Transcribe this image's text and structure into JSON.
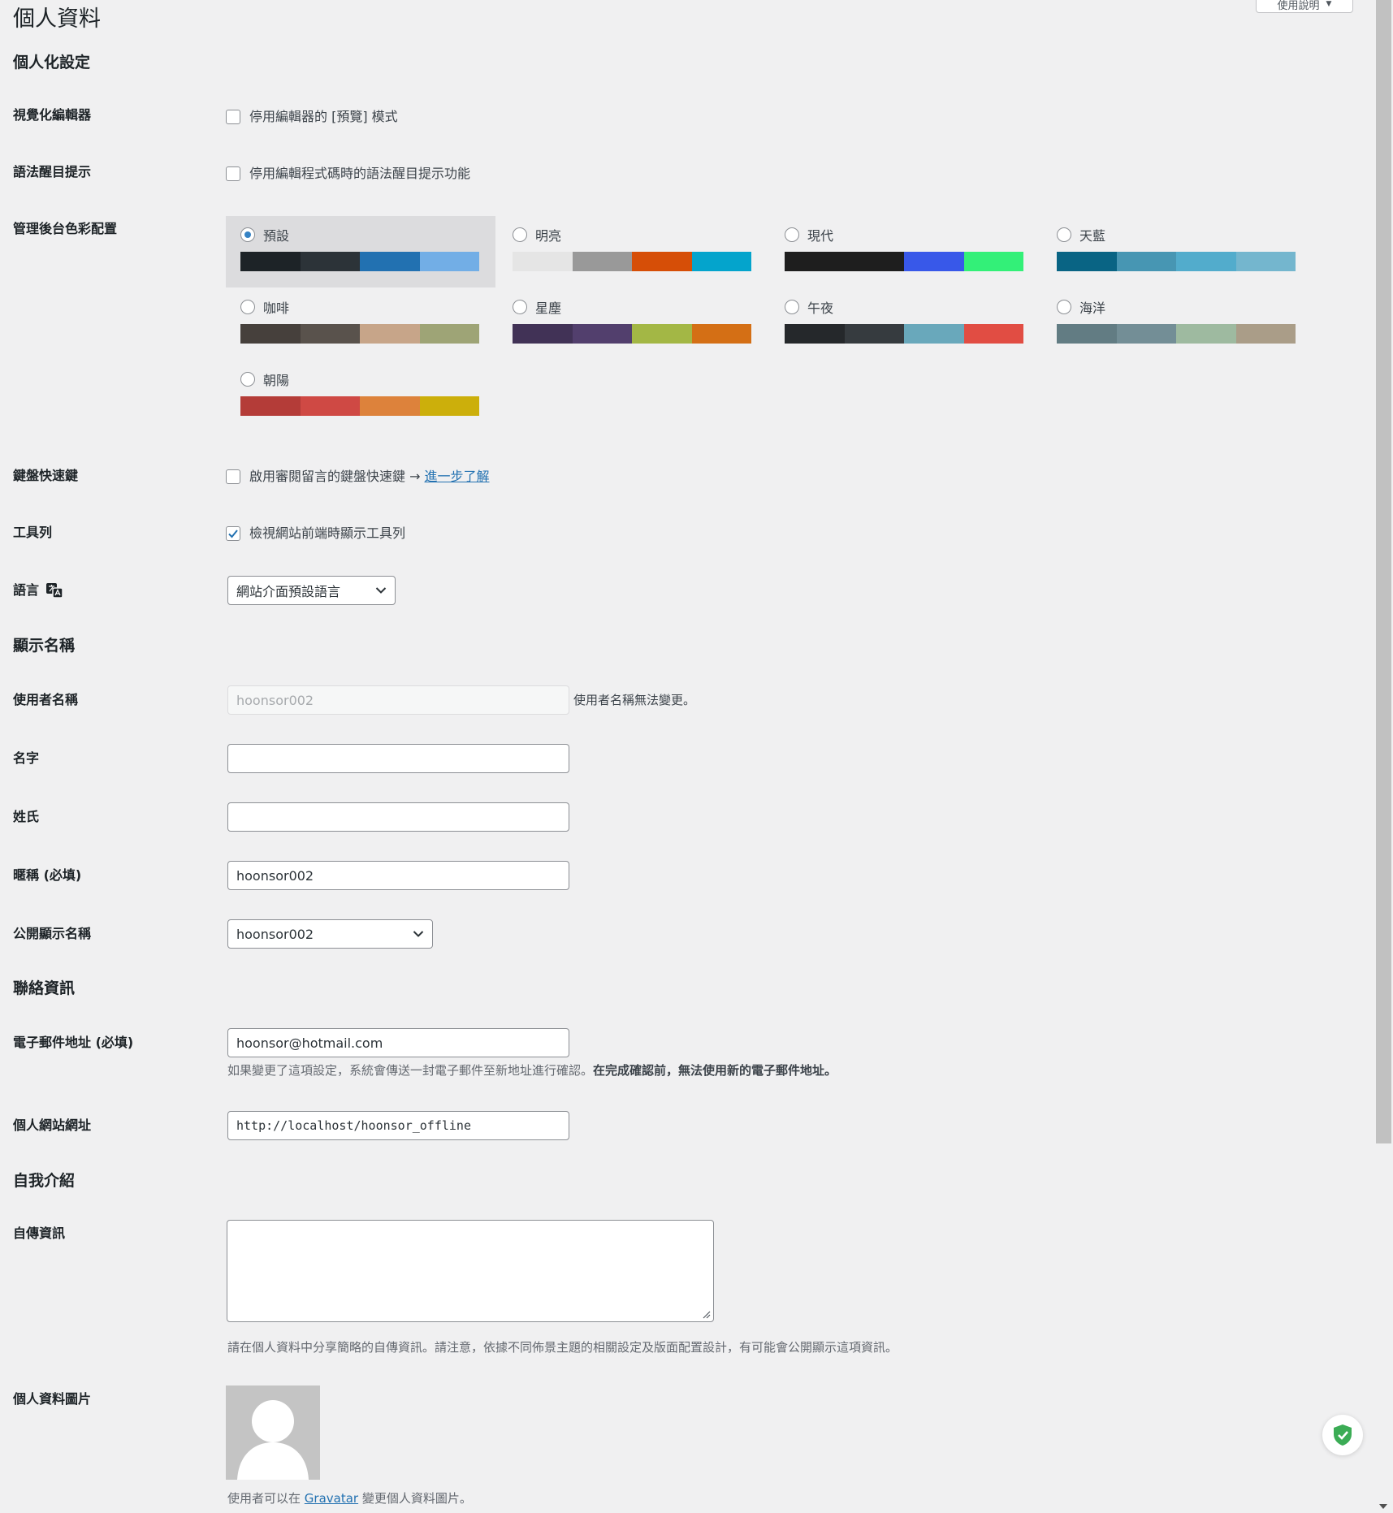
{
  "page": {
    "title": "個人資料",
    "help_label": "使用說明"
  },
  "sections": {
    "personal": "個人化設定",
    "name": "顯示名稱",
    "contact": "聯絡資訊",
    "about": "自我介紹"
  },
  "fields": {
    "visual_editor": {
      "label": "視覺化編輯器",
      "option": "停用編輯器的 [預覽] 模式",
      "checked": false
    },
    "syntax": {
      "label": "語法醒目提示",
      "option": "停用編輯程式碼時的語法醒目提示功能",
      "checked": false
    },
    "color_scheme": {
      "label": "管理後台色彩配置",
      "schemes": [
        {
          "name": "預設",
          "selected": true,
          "colors": [
            "#1d2327",
            "#2c3338",
            "#2271b1",
            "#72aee6"
          ]
        },
        {
          "name": "明亮",
          "selected": false,
          "colors": [
            "#e5e5e5",
            "#999999",
            "#d64e07",
            "#04a4cc"
          ]
        },
        {
          "name": "現代",
          "selected": false,
          "colors": [
            "#1e1e1e",
            "#1e1e1e",
            "#3858e9",
            "#33f078"
          ]
        },
        {
          "name": "天藍",
          "selected": false,
          "colors": [
            "#096484",
            "#4796b3",
            "#52accc",
            "#74b6ce"
          ]
        },
        {
          "name": "咖啡",
          "selected": false,
          "colors": [
            "#46403c",
            "#59524c",
            "#c7a589",
            "#9ea476"
          ]
        },
        {
          "name": "星塵",
          "selected": false,
          "colors": [
            "#413256",
            "#523f6d",
            "#a3b745",
            "#d46f15"
          ]
        },
        {
          "name": "午夜",
          "selected": false,
          "colors": [
            "#25282b",
            "#363b3f",
            "#69a8bb",
            "#e14d43"
          ]
        },
        {
          "name": "海洋",
          "selected": false,
          "colors": [
            "#627c83",
            "#738e96",
            "#9ebaa0",
            "#aa9d88"
          ]
        },
        {
          "name": "朝陽",
          "selected": false,
          "colors": [
            "#b43c38",
            "#cf4944",
            "#dd823b",
            "#ccaf0b"
          ]
        }
      ]
    },
    "keyboard": {
      "label": "鍵盤快速鍵",
      "option": "啟用審閱留言的鍵盤快速鍵 →",
      "link": "進一步了解",
      "checked": false
    },
    "toolbar": {
      "label": "工具列",
      "option": "檢視網站前端時顯示工具列",
      "checked": true
    },
    "language": {
      "label": "語言",
      "value": "網站介面預設語言"
    },
    "username": {
      "label": "使用者名稱",
      "value": "hoonsor002",
      "note": "使用者名稱無法變更。"
    },
    "first_name": {
      "label": "名字",
      "value": ""
    },
    "last_name": {
      "label": "姓氏",
      "value": ""
    },
    "nickname": {
      "label": "暱稱 (必填)",
      "value": "hoonsor002"
    },
    "display_name": {
      "label": "公開顯示名稱",
      "value": "hoonsor002"
    },
    "email": {
      "label": "電子郵件地址 (必填)",
      "value": "hoonsor@hotmail.com",
      "desc_plain": "如果變更了這項設定，系統會傳送一封電子郵件至新地址進行確認。",
      "desc_bold": "在完成確認前，無法使用新的電子郵件地址。"
    },
    "website": {
      "label": "個人網站網址",
      "value": "http://localhost/hoonsor_offline"
    },
    "bio": {
      "label": "自傳資訊",
      "value": "",
      "desc": "請在個人資料中分享簡略的自傳資訊。請注意，依據不同佈景主題的相關設定及版面配置設計，有可能會公開顯示這項資訊。"
    },
    "avatar": {
      "label": "個人資料圖片",
      "desc_pre": "使用者可以在",
      "link": "Gravatar",
      "desc_post": "變更個人資料圖片。"
    }
  }
}
